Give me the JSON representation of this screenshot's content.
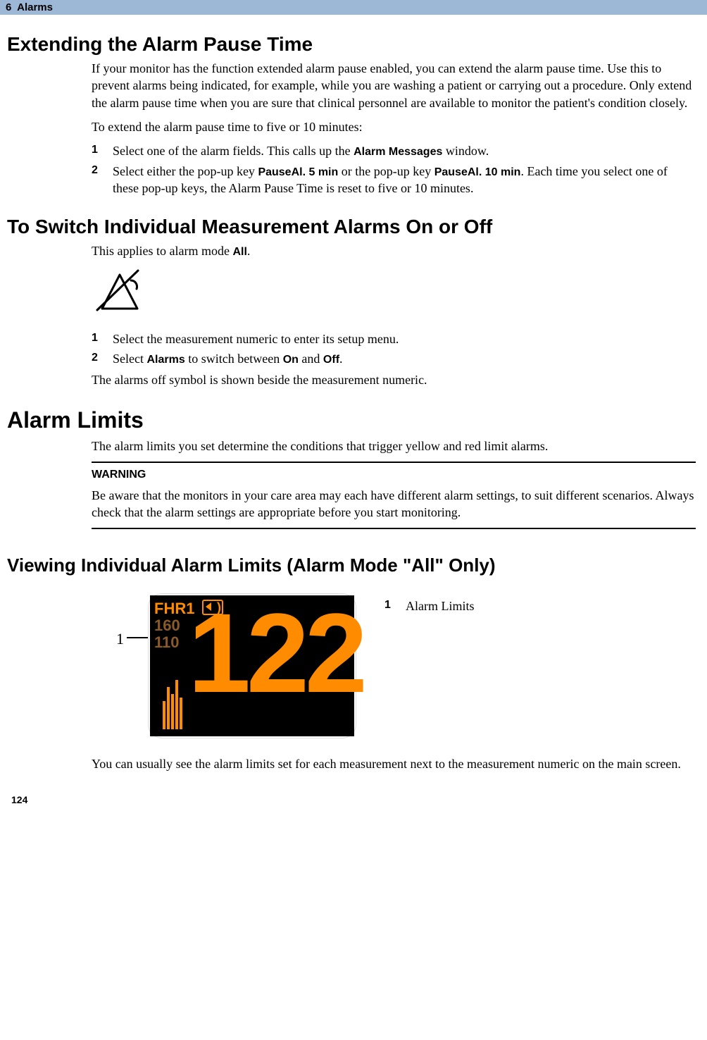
{
  "header": {
    "chapter": "6",
    "title": "Alarms"
  },
  "section1": {
    "heading": "Extending the Alarm Pause Time",
    "p1": "If your monitor has the function extended alarm pause enabled, you can extend the alarm pause time. Use this to prevent alarms being indicated, for example, while you are washing a patient or carrying out a procedure. Only extend the alarm pause time when you are sure that clinical personnel are available to monitor the patient's condition closely.",
    "p2": "To extend the alarm pause time to five or 10 minutes:",
    "step1_a": "Select one of the alarm fields. This calls up the ",
    "step1_ui": "Alarm Messages",
    "step1_b": " window.",
    "step2_a": "Select either the pop-up key ",
    "step2_ui1": "PauseAl. 5 min",
    "step2_b": " or the pop-up key ",
    "step2_ui2": "PauseAl. 10 min",
    "step2_c": ". Each time you select one of these pop-up keys, the Alarm Pause Time is reset to five or 10 minutes."
  },
  "section2": {
    "heading": "To Switch Individual Measurement Alarms On or Off",
    "p1_a": "This applies to alarm mode ",
    "p1_ui": "All",
    "p1_b": ".",
    "step1": "Select the measurement numeric to enter its setup menu.",
    "step2_a": "Select ",
    "step2_ui1": "Alarms",
    "step2_b": " to switch between ",
    "step2_ui2": "On",
    "step2_c": " and ",
    "step2_ui3": "Off",
    "step2_d": ".",
    "p2": "The alarms off symbol is shown beside the measurement numeric."
  },
  "section3": {
    "heading": "Alarm Limits",
    "p1": "The alarm limits you set determine the conditions that trigger yellow and red limit alarms.",
    "warn_label": "WARNING",
    "warn_text": "Be aware that the monitors in your care area may each have different alarm settings, to suit different scenarios. Always check that the alarm settings are appropriate before you start monitoring."
  },
  "section4": {
    "heading": "Viewing Individual Alarm Limits (Alarm Mode \"All\" Only)",
    "callout_num": "1",
    "callout_label": "Alarm Limits",
    "tile": {
      "label": "FHR1",
      "upper": "160",
      "lower": "110",
      "value": "122"
    },
    "p1": "You can usually see the alarm limits set for each measurement next to the measurement numeric on the main screen."
  },
  "list_nums": {
    "one": "1",
    "two": "2"
  },
  "page_number": "124"
}
